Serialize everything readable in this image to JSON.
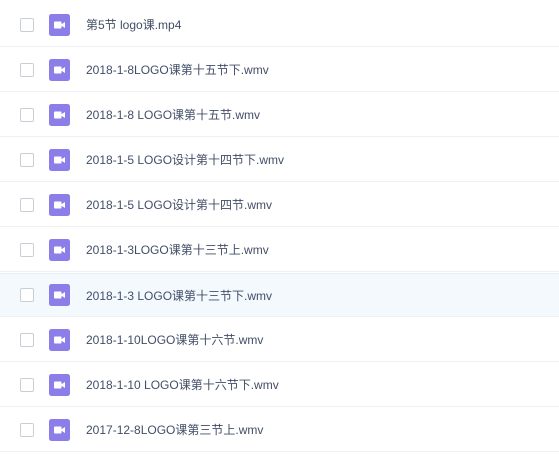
{
  "files": [
    {
      "name": "第5节 logo课.mp4",
      "icon": "video-file-icon"
    },
    {
      "name": "2018-1-8LOGO课第十五节下.wmv",
      "icon": "video-file-icon"
    },
    {
      "name": "2018-1-8 LOGO课第十五节.wmv",
      "icon": "video-file-icon"
    },
    {
      "name": "2018-1-5 LOGO设计第十四节下.wmv",
      "icon": "video-file-icon"
    },
    {
      "name": "2018-1-5 LOGO设计第十四节.wmv",
      "icon": "video-file-icon"
    },
    {
      "name": "2018-1-3LOGO课第十三节上.wmv",
      "icon": "video-file-icon"
    },
    {
      "name": "2018-1-3 LOGO课第十三节下.wmv",
      "icon": "video-file-icon",
      "hovered": true
    },
    {
      "name": "2018-1-10LOGO课第十六节.wmv",
      "icon": "video-file-icon"
    },
    {
      "name": "2018-1-10 LOGO课第十六节下.wmv",
      "icon": "video-file-icon"
    },
    {
      "name": "2017-12-8LOGO课第三节上.wmv",
      "icon": "video-file-icon"
    }
  ],
  "colors": {
    "icon": "#8c7ee8",
    "text": "#424e67",
    "hover_bg": "#f4f9fe",
    "divider": "#eef0f4"
  }
}
